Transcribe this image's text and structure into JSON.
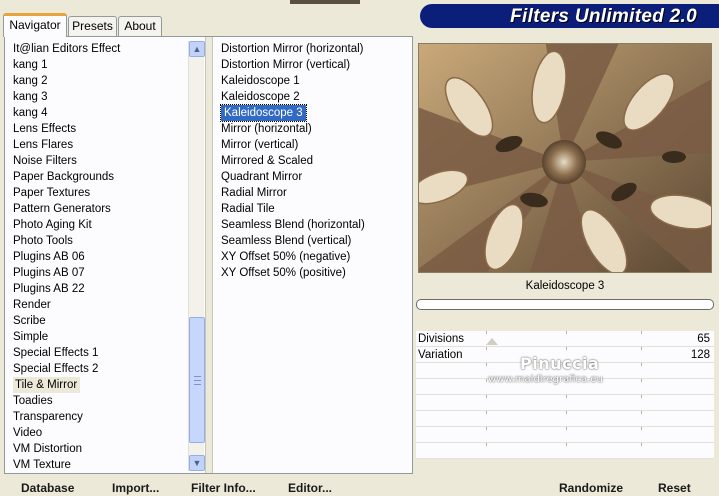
{
  "tabs": [
    {
      "label": "Navigator",
      "active": true
    },
    {
      "label": "Presets",
      "active": false
    },
    {
      "label": "About",
      "active": false
    }
  ],
  "logo": {
    "text": "Filters Unlimited 2.0",
    "color": "#0a1e7a"
  },
  "categories": [
    "It@lian Editors Effect",
    "kang 1",
    "kang 2",
    "kang 3",
    "kang 4",
    "Lens Effects",
    "Lens Flares",
    "Noise Filters",
    "Paper Backgrounds",
    "Paper Textures",
    "Pattern Generators",
    "Photo Aging Kit",
    "Photo Tools",
    "Plugins AB 06",
    "Plugins AB 07",
    "Plugins AB 22",
    "Render",
    "Scribe",
    "Simple",
    "Special Effects 1",
    "Special Effects 2",
    "Tile & Mirror",
    "Toadies",
    "Transparency",
    "Video",
    "VM Distortion",
    "VM Texture"
  ],
  "selected_category": "Tile & Mirror",
  "filters": [
    "Distortion Mirror (horizontal)",
    "Distortion Mirror (vertical)",
    "Kaleidoscope 1",
    "Kaleidoscope 2",
    "Kaleidoscope 3",
    "Mirror (horizontal)",
    "Mirror (vertical)",
    "Mirrored & Scaled",
    "Quadrant Mirror",
    "Radial Mirror",
    "Radial Tile",
    "Seamless Blend (horizontal)",
    "Seamless Blend (vertical)",
    "XY Offset 50% (negative)",
    "XY Offset 50% (positive)"
  ],
  "selected_filter": "Kaleidoscope 3",
  "preview": {
    "label": "Kaleidoscope 3",
    "progress": 0
  },
  "params": [
    {
      "label": "Divisions",
      "value": "65"
    },
    {
      "label": "Variation",
      "value": "128"
    }
  ],
  "watermark": {
    "name": "Pinuccia",
    "url": "www.maidiregrafica.eu"
  },
  "buttons": {
    "database": "Database",
    "import": "Import...",
    "filter_info": "Filter Info...",
    "editor": "Editor...",
    "randomize": "Randomize",
    "reset": "Reset"
  },
  "colors": {
    "selection": "#316ac5",
    "scroll": "#c1d3fb",
    "tab_accent": "#e8a33d"
  }
}
